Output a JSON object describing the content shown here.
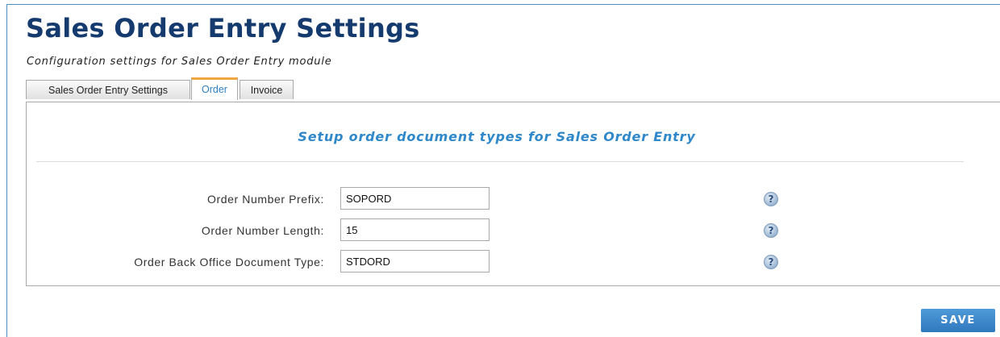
{
  "page": {
    "title": "Sales Order Entry Settings",
    "subtitle": "Configuration settings for Sales Order Entry module"
  },
  "tabs": [
    {
      "label": "Sales Order Entry Settings",
      "active": false
    },
    {
      "label": "Order",
      "active": true
    },
    {
      "label": "Invoice",
      "active": false
    }
  ],
  "panel": {
    "heading": "Setup order document types for Sales Order Entry",
    "fields": [
      {
        "label": "Order Number Prefix:",
        "value": "SOPORD",
        "help_icon": "question-icon"
      },
      {
        "label": "Order Number Length:",
        "value": "15",
        "help_icon": "question-icon"
      },
      {
        "label": "Order Back Office Document Type:",
        "value": "STDORD",
        "help_icon": "question-icon"
      }
    ]
  },
  "actions": {
    "save_label": "SAVE"
  },
  "colors": {
    "title": "#153a6e",
    "heading": "#2f88c9",
    "active_tab_accent": "#f0a640",
    "save_button": "#3a84c8"
  },
  "help_glyph": "?"
}
